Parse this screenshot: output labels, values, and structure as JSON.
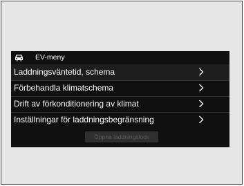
{
  "header": {
    "icon": "car-icon",
    "title": "EV-meny"
  },
  "menu": {
    "items": [
      {
        "label": "Laddningsväntetid, schema",
        "icon": "chevron-right-icon"
      },
      {
        "label": "Förbehandla klimatschema",
        "icon": "chevron-right-icon"
      },
      {
        "label": "Drift av förkonditionering av klimat",
        "icon": "chevron-right-icon"
      },
      {
        "label": "Inställningar för laddningsbegränsning",
        "icon": "chevron-right-icon"
      }
    ]
  },
  "footer": {
    "button_label": "Öppna laddningslock",
    "button_state": "disabled"
  },
  "colors": {
    "screen_bg": "#101010",
    "highlight_row": "#1e1e1e",
    "frame_bg": "#e6e6e6",
    "text": "#ffffff",
    "disabled_text": "#5e5e5e"
  }
}
